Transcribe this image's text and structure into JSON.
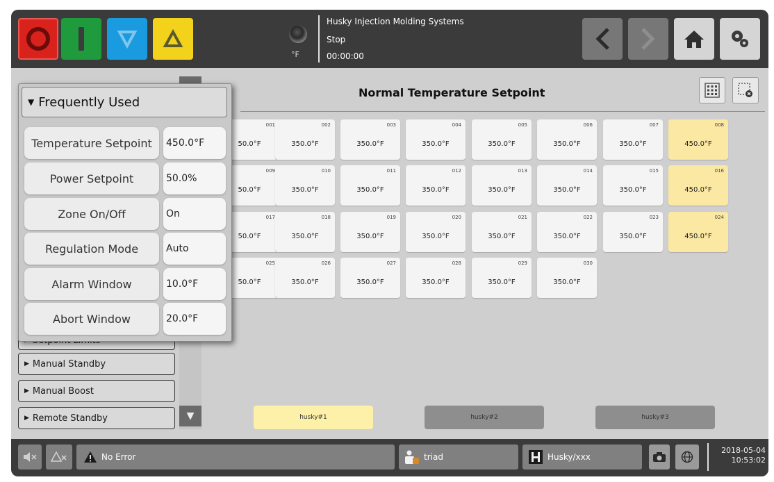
{
  "header": {
    "machine_name": "Husky Injection Molding Systems",
    "state": "Stop",
    "timer": "00:00:00",
    "unit": "°F"
  },
  "panel": {
    "title": "Normal Temperature Setpoint"
  },
  "zones": [
    {
      "num": "001",
      "value": "50.0°F",
      "hot": false
    },
    {
      "num": "002",
      "value": "350.0°F",
      "hot": false
    },
    {
      "num": "003",
      "value": "350.0°F",
      "hot": false
    },
    {
      "num": "004",
      "value": "350.0°F",
      "hot": false
    },
    {
      "num": "005",
      "value": "350.0°F",
      "hot": false
    },
    {
      "num": "006",
      "value": "350.0°F",
      "hot": false
    },
    {
      "num": "007",
      "value": "350.0°F",
      "hot": false
    },
    {
      "num": "008",
      "value": "450.0°F",
      "hot": true
    },
    {
      "num": "009",
      "value": "50.0°F",
      "hot": false
    },
    {
      "num": "010",
      "value": "350.0°F",
      "hot": false
    },
    {
      "num": "011",
      "value": "350.0°F",
      "hot": false
    },
    {
      "num": "012",
      "value": "350.0°F",
      "hot": false
    },
    {
      "num": "013",
      "value": "350.0°F",
      "hot": false
    },
    {
      "num": "014",
      "value": "350.0°F",
      "hot": false
    },
    {
      "num": "015",
      "value": "350.0°F",
      "hot": false
    },
    {
      "num": "016",
      "value": "450.0°F",
      "hot": true
    },
    {
      "num": "017",
      "value": "50.0°F",
      "hot": false
    },
    {
      "num": "018",
      "value": "350.0°F",
      "hot": false
    },
    {
      "num": "019",
      "value": "350.0°F",
      "hot": false
    },
    {
      "num": "020",
      "value": "350.0°F",
      "hot": false
    },
    {
      "num": "021",
      "value": "350.0°F",
      "hot": false
    },
    {
      "num": "022",
      "value": "350.0°F",
      "hot": false
    },
    {
      "num": "023",
      "value": "350.0°F",
      "hot": false
    },
    {
      "num": "024",
      "value": "450.0°F",
      "hot": true
    },
    {
      "num": "025",
      "value": "50.0°F",
      "hot": false
    },
    {
      "num": "026",
      "value": "350.0°F",
      "hot": false
    },
    {
      "num": "027",
      "value": "350.0°F",
      "hot": false
    },
    {
      "num": "028",
      "value": "350.0°F",
      "hot": false
    },
    {
      "num": "029",
      "value": "350.0°F",
      "hot": false
    },
    {
      "num": "030",
      "value": "350.0°F",
      "hot": false
    }
  ],
  "sidebar": {
    "items": [
      "Setpoint Limits",
      "Manual Standby",
      "Manual Boost",
      "Remote Standby"
    ]
  },
  "popup": {
    "title": "Frequently Used",
    "rows": [
      {
        "label": "Temperature Setpoint",
        "value": "450.0°F"
      },
      {
        "label": "Power Setpoint",
        "value": "50.0%"
      },
      {
        "label": "Zone On/Off",
        "value": "On"
      },
      {
        "label": "Regulation Mode",
        "value": "Auto"
      },
      {
        "label": "Alarm Window",
        "value": "10.0°F"
      },
      {
        "label": "Abort Window",
        "value": "20.0°F"
      }
    ]
  },
  "profiles": [
    {
      "label": "husky#1",
      "active": true
    },
    {
      "label": "husky#2",
      "active": false
    },
    {
      "label": "husky#3",
      "active": false
    }
  ],
  "status": {
    "error_text": "No Error",
    "user": "triad",
    "mold": "Husky/xxx",
    "date": "2018-05-04",
    "time": "10:53:02"
  },
  "colors": {
    "stop": "#d9221c",
    "start": "#1f9a3c",
    "decrease": "#1a9be0",
    "increase": "#f2d21b",
    "zone_hot": "#fbe8a2",
    "profile_active": "#fdf0a8"
  }
}
